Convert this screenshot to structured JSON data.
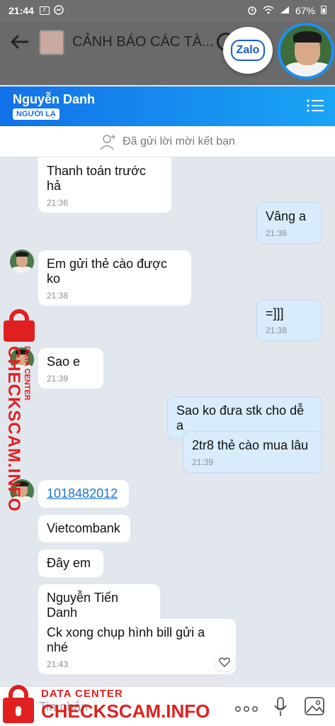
{
  "status": {
    "time": "21:44",
    "battery": "67%"
  },
  "dim_header": {
    "title": "CẢNH BÁO CÁC TÀ..."
  },
  "overlay": {
    "zalo_label": "Zalo"
  },
  "chat": {
    "contact_name": "Nguyễn Danh",
    "contact_tag": "NGƯỜI LẠ",
    "friend_request_text": "Đã gửi lời mời kết bạn"
  },
  "messages": [
    {
      "from": "them",
      "text": "Thanh toán trước hả",
      "time": "21:36"
    },
    {
      "from": "me",
      "text": "Vâng a",
      "time": "21:36"
    },
    {
      "from": "them",
      "text": "Em gửi thẻ cào được ko",
      "time": "21:38"
    },
    {
      "from": "me",
      "text": "=]]]",
      "time": "21:38"
    },
    {
      "from": "them",
      "text": "Sao e",
      "time": "21:39"
    },
    {
      "from": "me",
      "text": "Sao ko đưa stk cho dễ a",
      "time": ""
    },
    {
      "from": "me",
      "text": "2tr8 thẻ cào mua lâu",
      "time": "21:39"
    },
    {
      "from": "them",
      "text": "1018482012",
      "time": ""
    },
    {
      "from": "them",
      "text": "Vietcombank",
      "time": ""
    },
    {
      "from": "them",
      "text": "Đây em",
      "time": ""
    },
    {
      "from": "them",
      "text": "Nguyễn Tiến Danh",
      "time": ""
    },
    {
      "from": "them",
      "text": "Ck xong chụp hình bill gửi a nhé",
      "time": "21:43"
    }
  ],
  "composer": {
    "placeholder": "Tin nhắn",
    "more_label": "ooo"
  },
  "watermark": {
    "line1": "DATA CENTER",
    "line2": "CHECKSCAM.INFO"
  },
  "colors": {
    "header_start": "#1271e8",
    "header_end": "#1aa4f5",
    "my_bubble": "#d8ecfb",
    "watermark": "#e02020",
    "link": "#1a74d1"
  },
  "icons": [
    "back-arrow-icon",
    "search-icon",
    "menu-icon",
    "add-friend-icon",
    "heart-icon",
    "mic-icon",
    "image-icon",
    "lock-icon"
  ]
}
